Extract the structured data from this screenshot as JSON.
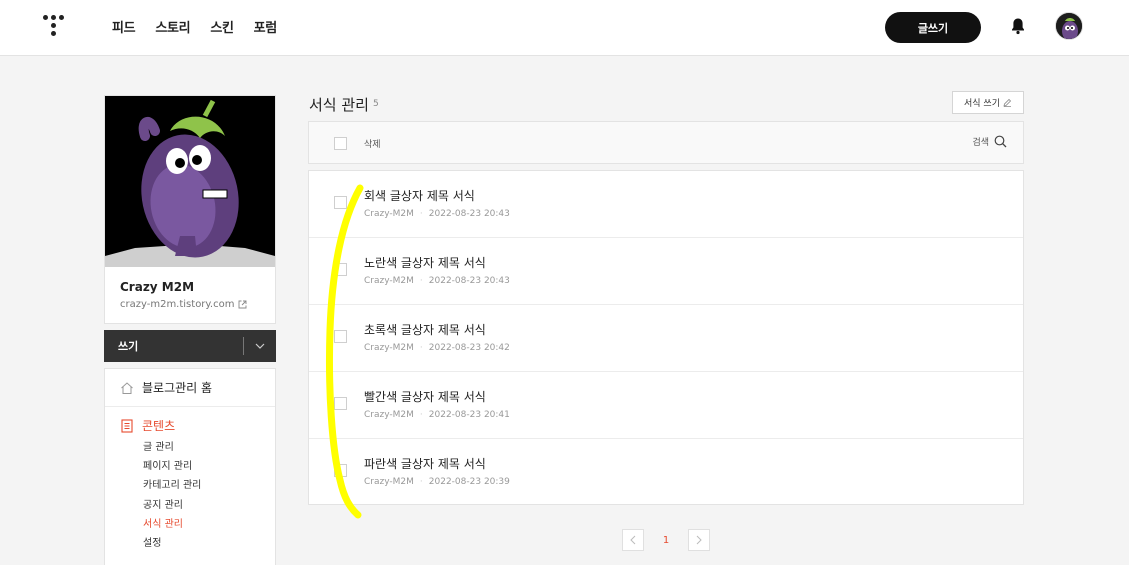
{
  "header": {
    "nav": [
      "피드",
      "스토리",
      "스킨",
      "포럼"
    ],
    "write_button": "글쓰기"
  },
  "profile": {
    "name": "Crazy M2M",
    "url": "crazy-m2m.tistory.com"
  },
  "sidebar": {
    "write_label": "쓰기",
    "home_label": "블로그관리 홈",
    "contents_title": "콘텐츠",
    "contents_items": [
      "글 관리",
      "페이지 관리",
      "카테고리 관리",
      "공지 관리",
      "서식 관리",
      "설정"
    ],
    "active_item": "서식 관리"
  },
  "main": {
    "title": "서식 관리",
    "count": "5",
    "new_button": "서식 쓰기",
    "delete_label": "삭제",
    "search_label": "검색",
    "rows": [
      {
        "title": "회색 글상자 제목 서식",
        "author": "Crazy-M2M",
        "date": "2022-08-23 20:43"
      },
      {
        "title": "노란색 글상자 제목 서식",
        "author": "Crazy-M2M",
        "date": "2022-08-23 20:43"
      },
      {
        "title": "초록색 글상자 제목 서식",
        "author": "Crazy-M2M",
        "date": "2022-08-23 20:42"
      },
      {
        "title": "빨간색 글상자 제목 서식",
        "author": "Crazy-M2M",
        "date": "2022-08-23 20:41"
      },
      {
        "title": "파란색 글상자 제목 서식",
        "author": "Crazy-M2M",
        "date": "2022-08-23 20:39"
      }
    ],
    "current_page": "1"
  },
  "colors": {
    "accent": "#e64a2e",
    "highlight": "#ffff00",
    "dark": "#333333"
  }
}
